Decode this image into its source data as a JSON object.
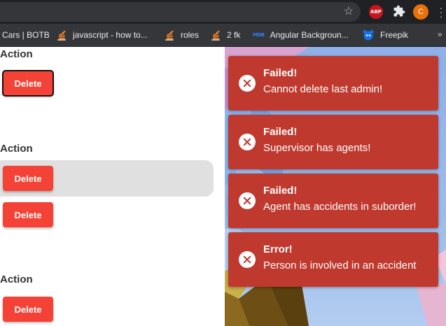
{
  "browser": {
    "extensions": {
      "abp_label": "ABP",
      "profile_initial": "C"
    },
    "bookmarks": [
      {
        "label": "Cars | BOTB",
        "icon": "none"
      },
      {
        "label": "javascript - how to...",
        "icon": "stackoverflow-icon"
      },
      {
        "label": "roles",
        "icon": "stackoverflow-icon"
      },
      {
        "label": "2 fk",
        "icon": "stackoverflow-icon"
      },
      {
        "label": "Angular Backgroun...",
        "icon": "mdb-icon",
        "icon_text": "MDB"
      },
      {
        "label": "Freepik",
        "icon": "freepik-icon"
      }
    ]
  },
  "page": {
    "sections": [
      {
        "heading": "Action",
        "buttons": [
          {
            "label": "Delete",
            "focused": true
          }
        ]
      },
      {
        "heading": "Action",
        "buttons": [
          {
            "label": "Delete",
            "highlighted_row": true
          },
          {
            "label": "Delete"
          }
        ]
      },
      {
        "heading": "Action",
        "buttons": [
          {
            "label": "Delete"
          }
        ]
      }
    ]
  },
  "toasts": [
    {
      "title": "Failed!",
      "message": "Cannot delete last admin!"
    },
    {
      "title": "Failed!",
      "message": "Supervisor has agents!"
    },
    {
      "title": "Failed!",
      "message": "Agent has accidents in suborder!"
    },
    {
      "title": "Error!",
      "message": "Person is involved in an accident"
    }
  ],
  "colors": {
    "toast_error": "#c0392f",
    "delete_button": "#f44336",
    "chrome_dark": "#202124",
    "bookmarks_bar": "#35363a"
  }
}
